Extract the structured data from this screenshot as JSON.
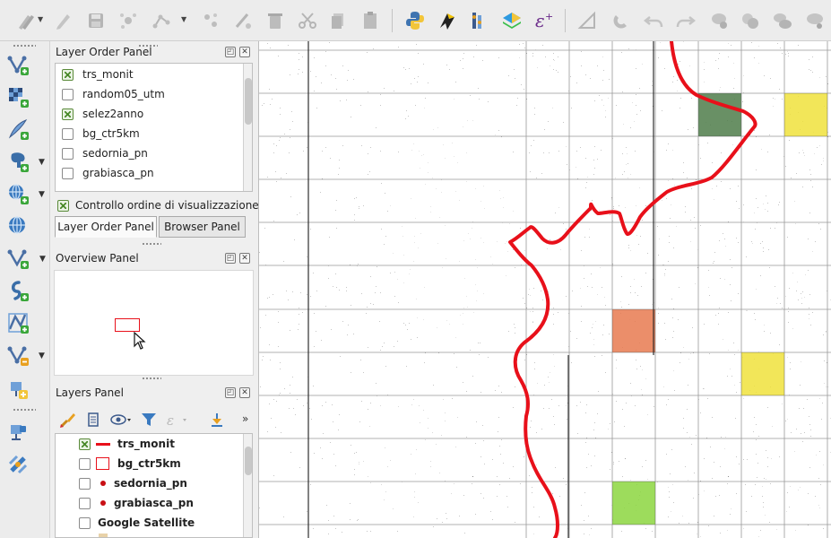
{
  "layer_order_panel": {
    "title": "Layer Order Panel",
    "layers": [
      {
        "name": "trs_monit",
        "checked": true
      },
      {
        "name": "random05_utm",
        "checked": false
      },
      {
        "name": "selez2anno",
        "checked": true
      },
      {
        "name": "bg_ctr5km",
        "checked": false
      },
      {
        "name": "sedornia_pn",
        "checked": false
      },
      {
        "name": "grabiasca_pn",
        "checked": false
      }
    ],
    "control_label": "Controllo ordine di visualizzazione",
    "tabs": [
      "Layer Order Panel",
      "Browser Panel"
    ]
  },
  "overview_panel": {
    "title": "Overview Panel"
  },
  "layers_panel": {
    "title": "Layers Panel",
    "layers": [
      {
        "name": "trs_monit",
        "checked": true,
        "symbol": "line-red"
      },
      {
        "name": "bg_ctr5km",
        "checked": false,
        "symbol": "polygon-red-outline"
      },
      {
        "name": "sedornia_pn",
        "checked": false,
        "symbol": "point-red"
      },
      {
        "name": "grabiasca_pn",
        "checked": false,
        "symbol": "point-red"
      },
      {
        "name": "Google Satellite",
        "checked": false,
        "symbol": "none"
      }
    ]
  },
  "colors": {
    "track_line": "#e8101a",
    "cell_dark_green": "#4f7d4a",
    "cell_yellow": "#f0e23c",
    "cell_orange": "#e87a50",
    "cell_light_green": "#8cd640"
  }
}
